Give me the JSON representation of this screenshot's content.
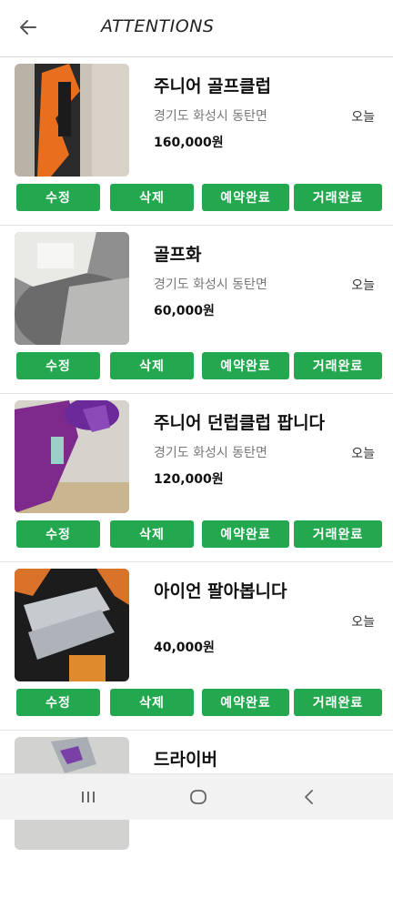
{
  "header": {
    "title": "ATTENTIONS",
    "back_icon": "arrow-left-icon"
  },
  "items": [
    {
      "name": "주니어 골프클럽",
      "location": "경기도 화성시 동탄면",
      "date": "오늘",
      "price": "160,000원",
      "buttons": {
        "edit": "수정",
        "delete": "삭제",
        "reserved": "예약완료",
        "sold": "거래완료"
      }
    },
    {
      "name": "골프화",
      "location": "경기도 화성시 동탄면",
      "date": "오늘",
      "price": "60,000원",
      "buttons": {
        "edit": "수정",
        "delete": "삭제",
        "reserved": "예약완료",
        "sold": "거래완료"
      }
    },
    {
      "name": "주니어 던럽클럽 팝니다",
      "location": "경기도 화성시 동탄면",
      "date": "오늘",
      "price": "120,000원",
      "buttons": {
        "edit": "수정",
        "delete": "삭제",
        "reserved": "예약완료",
        "sold": "거래완료"
      }
    },
    {
      "name": "아이언  팔아봅니다",
      "location": "",
      "date": "오늘",
      "price": "40,000원",
      "buttons": {
        "edit": "수정",
        "delete": "삭제",
        "reserved": "예약완료",
        "sold": "거래완료"
      }
    },
    {
      "name": "드라이버"
    }
  ],
  "nav": {
    "recent_icon": "recent-apps-icon",
    "home_icon": "home-icon",
    "back_icon": "back-chevron-icon"
  },
  "colors": {
    "button_green": "#24a84f",
    "background": "#ffffff",
    "nav_bg": "#f2f2f2"
  }
}
